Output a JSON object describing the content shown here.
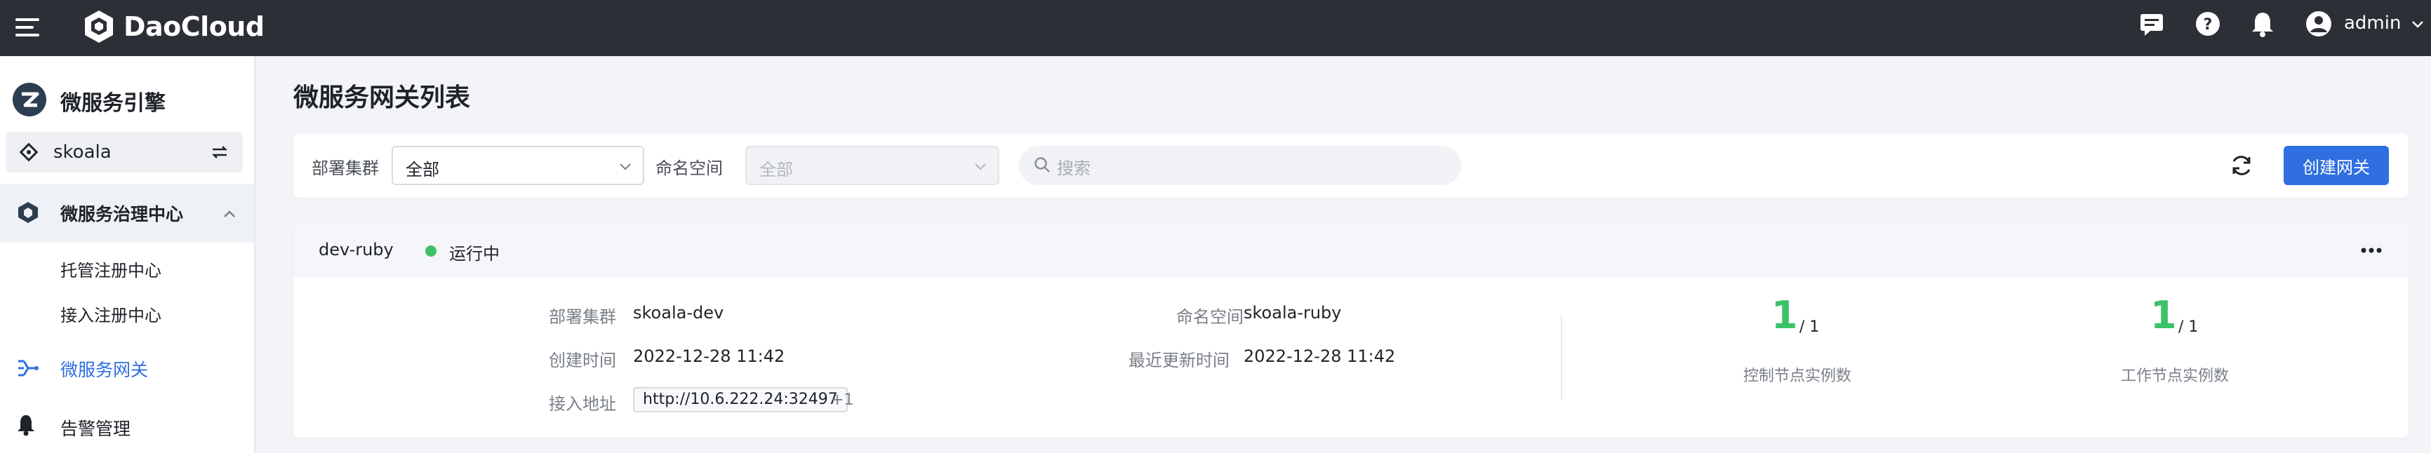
{
  "topbar": {
    "brand": "DaoCloud",
    "user": "admin",
    "icons": [
      "menu-icon",
      "message-icon",
      "help-icon",
      "bell-icon",
      "user-avatar-icon",
      "chevron-down-icon"
    ]
  },
  "sidebar": {
    "title": "微服务引擎",
    "workspace": "skoala",
    "group": {
      "label": "微服务治理中心",
      "items": [
        "托管注册中心",
        "接入注册中心"
      ]
    },
    "items": [
      {
        "label": "微服务网关",
        "active": true,
        "icon": "gateway-icon"
      },
      {
        "label": "告警管理",
        "active": false,
        "icon": "bell-icon"
      }
    ]
  },
  "main": {
    "title": "微服务网关列表",
    "filters": {
      "cluster_label": "部署集群",
      "cluster_value": "全部",
      "namespace_label": "命名空间",
      "namespace_value": "全部",
      "search_placeholder": "搜索"
    },
    "create_button": "创建网关"
  },
  "gateway": {
    "name": "dev-ruby",
    "status": "运行中",
    "cluster_label": "部署集群",
    "cluster": "skoala-dev",
    "namespace_label": "命名空间",
    "namespace": "skoala-ruby",
    "created_label": "创建时间",
    "created": "2022-12-28 11:42",
    "updated_label": "最近更新时间",
    "updated": "2022-12-28 11:42",
    "address_label": "接入地址",
    "address": "http://10.6.222.24:32497",
    "address_more": "+1",
    "control_nodes": {
      "ready": "1",
      "total": "/ 1",
      "label": "控制节点实例数"
    },
    "worker_nodes": {
      "ready": "1",
      "total": "/ 1",
      "label": "工作节点实例数"
    }
  },
  "colors": {
    "topbar": "#2c2f36",
    "accent": "#2f6fe0",
    "running": "#3cc36a"
  }
}
